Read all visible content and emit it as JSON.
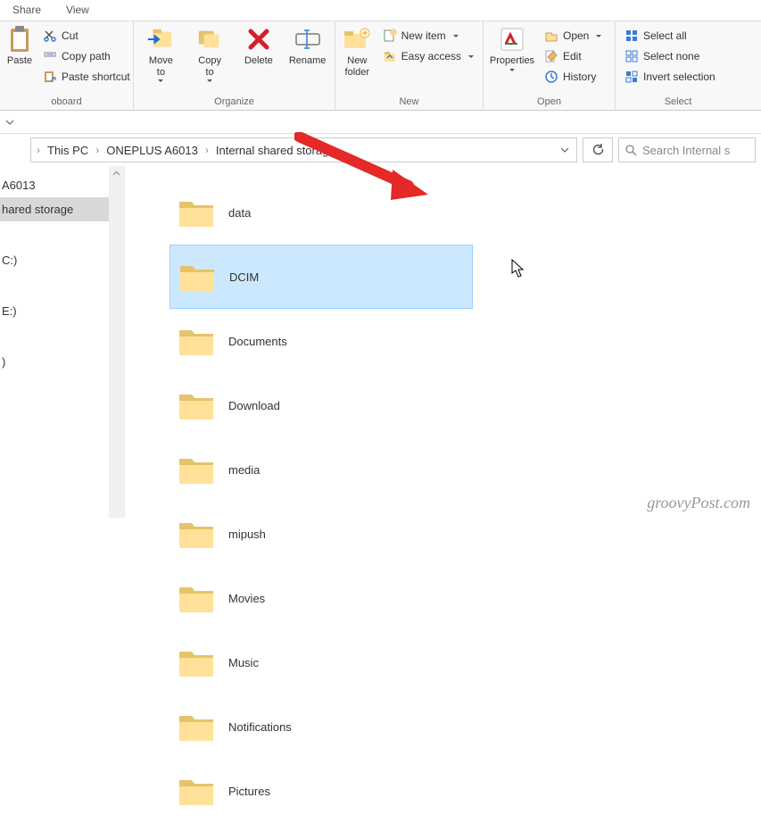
{
  "tabs": {
    "share": "Share",
    "view": "View"
  },
  "ribbon": {
    "clipboard": {
      "label": "oboard",
      "paste": "Paste",
      "cut": "Cut",
      "copy_path": "Copy path",
      "paste_shortcut": "Paste shortcut"
    },
    "organize": {
      "label": "Organize",
      "move_to": "Move\nto",
      "copy_to": "Copy\nto",
      "delete": "Delete",
      "rename": "Rename"
    },
    "new": {
      "label": "New",
      "new_folder": "New\nfolder",
      "new_item": "New item",
      "easy_access": "Easy access"
    },
    "open": {
      "label": "Open",
      "properties": "Properties",
      "open": "Open",
      "edit": "Edit",
      "history": "History"
    },
    "select": {
      "label": "Select",
      "select_all": "Select all",
      "select_none": "Select none",
      "invert": "Invert selection"
    }
  },
  "breadcrumb": {
    "items": [
      "This PC",
      "ONEPLUS A6013",
      "Internal shared storage"
    ]
  },
  "search": {
    "placeholder": "Search Internal s"
  },
  "sidebar": {
    "items": [
      {
        "label": "A6013",
        "selected": false
      },
      {
        "label": "hared storage",
        "selected": true
      },
      {
        "label": "C:)",
        "selected": false
      },
      {
        "label": "E:)",
        "selected": false
      },
      {
        "label": ")",
        "selected": false
      }
    ]
  },
  "folders": [
    {
      "name": "data"
    },
    {
      "name": "DCIM",
      "selected": true
    },
    {
      "name": "Documents"
    },
    {
      "name": "Download"
    },
    {
      "name": "media"
    },
    {
      "name": "mipush"
    },
    {
      "name": "Movies"
    },
    {
      "name": "Music"
    },
    {
      "name": "Notifications"
    },
    {
      "name": "Pictures"
    }
  ],
  "watermark": "groovyPost.com"
}
